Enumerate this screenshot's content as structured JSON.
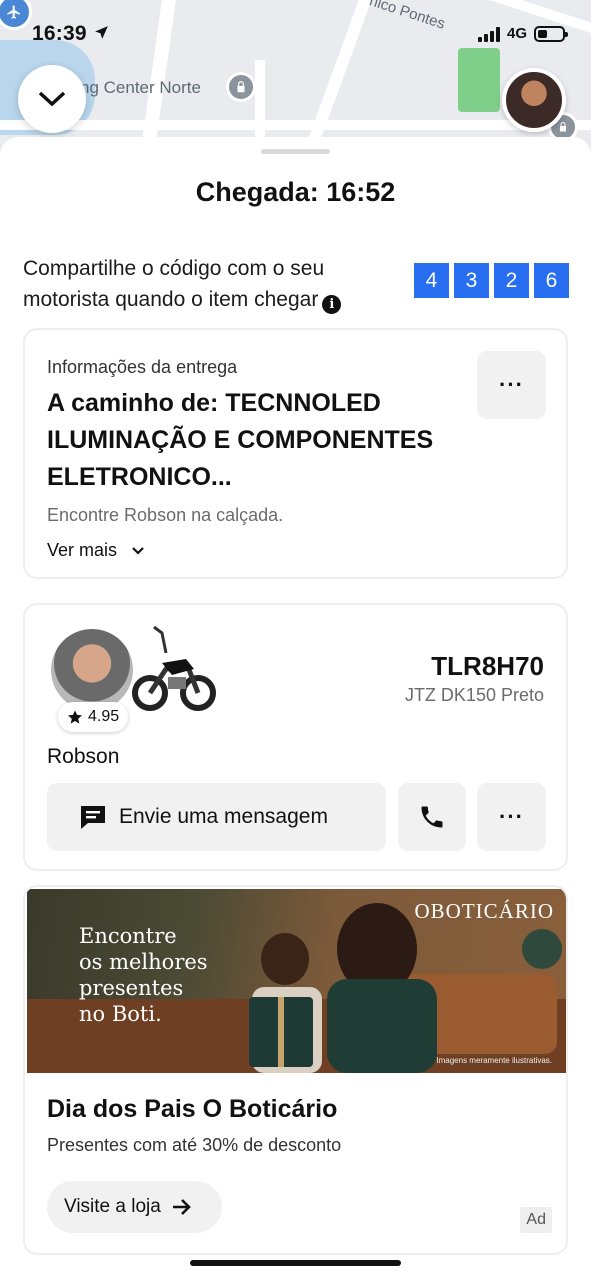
{
  "status_bar": {
    "time": "16:39",
    "network": "4G"
  },
  "map": {
    "label_main": "ng Center Norte",
    "label_street": "nico Pontes"
  },
  "trip": {
    "arrival": "Chegada: 16:52",
    "code_prompt": "Compartilhe o código com o seu motorista quando o item chegar",
    "code_digits": [
      "4",
      "3",
      "2",
      "6"
    ]
  },
  "delivery": {
    "section_label": "Informações da entrega",
    "destination": "A caminho de: TECNNOLED ILUMINAÇÃO E COMPONENTES ELETRONICO...",
    "note": "Encontre Robson na calçada.",
    "see_more": "Ver mais",
    "more_button": "···"
  },
  "driver": {
    "rating": "4.95",
    "name": "Robson",
    "plate": "TLR8H70",
    "vehicle": "JTZ DK150 Preto",
    "message_button": "Envie uma mensagem",
    "more_button": "···"
  },
  "ad": {
    "headline": "Encontre\nos melhores\npresentes\nno Boti.",
    "brand": "OBOTICÁRIO",
    "disclaimer": "Imagens meramente ilustrativas.",
    "title": "Dia dos Pais O Boticário",
    "subtitle": "Presentes com até 30% de desconto",
    "cta": "Visite a loja",
    "badge": "Ad"
  },
  "colors": {
    "accent_blue": "#276ef1",
    "button_gray": "#f1f1f1"
  }
}
